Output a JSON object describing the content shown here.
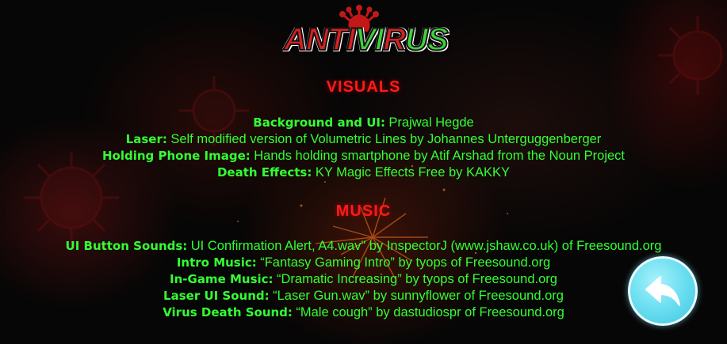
{
  "logo": {
    "text_part1": "ANTI",
    "text_part2": "VI",
    "text_part3": "R",
    "text_part4": "US",
    "icon": "virus-icon"
  },
  "sections": [
    {
      "title": "VISUALS",
      "credits": [
        {
          "label": "Background and UI:",
          "value": "Prajwal Hegde"
        },
        {
          "label": "Laser:",
          "value": "Self modified version of Volumetric Lines by Johannes Unterguggenberger"
        },
        {
          "label": "Holding Phone Image:",
          "value": "Hands holding smartphone by Atif Arshad from the Noun Project"
        },
        {
          "label": "Death Effects:",
          "value": "KY Magic Effects Free by KAKKY"
        }
      ]
    },
    {
      "title": "MUSIC",
      "credits": [
        {
          "label": "UI Button Sounds:",
          "value": "UI Confirmation Alert, A4.wav\" by InspectorJ (www.jshaw.co.uk) of Freesound.org"
        },
        {
          "label": "Intro Music:",
          "value": "“Fantasy Gaming Intro” by tyops of Freesound.org"
        },
        {
          "label": "In-Game Music:",
          "value": "“Dramatic Increasing” by tyops of Freesound.org"
        },
        {
          "label": "Laser UI Sound:",
          "value": "“Laser Gun.wav” by sunnyflower of Freesound.org"
        },
        {
          "label": "Virus Death Sound:",
          "value": "“Male cough” by dastudiospr of Freesound.org"
        }
      ]
    }
  ],
  "back_button": {
    "icon": "back-arrow-icon"
  },
  "colors": {
    "heading": "#ff1a1a",
    "credit_text": "#33ff33",
    "back_button": "#6fe0f2",
    "logo_red": "#d92020",
    "logo_green": "#3fd23a"
  }
}
